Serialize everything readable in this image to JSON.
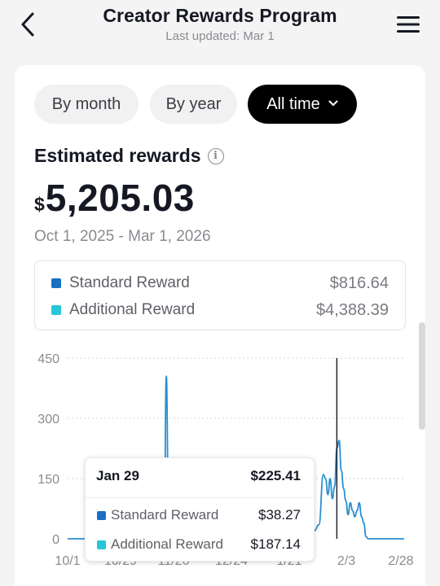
{
  "header": {
    "title": "Creator Rewards Program",
    "subtitle": "Last updated: Mar 1"
  },
  "filters": {
    "by_month": "By month",
    "by_year": "By year",
    "all_time": "All time",
    "selected": "All time"
  },
  "summary": {
    "label": "Estimated rewards",
    "currency": "$",
    "amount": "5,205.03",
    "date_range": "Oct 1, 2025 - Mar 1, 2026"
  },
  "legend": [
    {
      "label": "Standard Reward",
      "value": "$816.64",
      "color": "#1a6fc4"
    },
    {
      "label": "Additional Reward",
      "value": "$4,388.39",
      "color": "#25c6da"
    }
  ],
  "tooltip": {
    "date": "Jan 29",
    "total": "$225.41",
    "rows": [
      {
        "label": "Standard Reward",
        "value": "$38.27",
        "color": "#1a6fc4"
      },
      {
        "label": "Additional Reward",
        "value": "$187.14",
        "color": "#25c6da"
      }
    ]
  },
  "chart_data": {
    "type": "line",
    "y_ticks": [
      "450",
      "300",
      "150",
      "0"
    ],
    "ylim": [
      0,
      450
    ],
    "x_ticks": [
      "10/1",
      "10/29",
      "11/26",
      "12/24",
      "1/21",
      "2/3",
      "2/28"
    ],
    "line_color": "#2a8fd0",
    "cursor_date": "Jan 29",
    "grid": "dashed horizontal",
    "points": [
      {
        "x": "10/1",
        "y": 0
      },
      {
        "x": "10/14",
        "y": 0
      },
      {
        "x": "10/15",
        "y": 2
      },
      {
        "x": "11/12",
        "y": 2
      },
      {
        "x": "11/13",
        "y": 8
      },
      {
        "x": "11/14",
        "y": 405
      },
      {
        "x": "11/15",
        "y": 70
      },
      {
        "x": "11/16",
        "y": 8
      },
      {
        "x": "11/17",
        "y": 2
      },
      {
        "x": "1/14",
        "y": 2
      },
      {
        "x": "1/17",
        "y": 55
      },
      {
        "x": "1/19",
        "y": 20
      },
      {
        "x": "1/21",
        "y": 35
      },
      {
        "x": "1/23",
        "y": 160
      },
      {
        "x": "1/24",
        "y": 150
      },
      {
        "x": "1/25",
        "y": 110
      },
      {
        "x": "1/26",
        "y": 150
      },
      {
        "x": "1/27",
        "y": 100
      },
      {
        "x": "1/28",
        "y": 130
      },
      {
        "x": "1/29",
        "y": 225
      },
      {
        "x": "1/30",
        "y": 245
      },
      {
        "x": "1/31",
        "y": 170
      },
      {
        "x": "2/1",
        "y": 125
      },
      {
        "x": "2/2",
        "y": 95
      },
      {
        "x": "2/3",
        "y": 60
      },
      {
        "x": "2/4",
        "y": 90
      },
      {
        "x": "2/5",
        "y": 70
      },
      {
        "x": "2/6",
        "y": 55
      },
      {
        "x": "2/7",
        "y": 70
      },
      {
        "x": "2/8",
        "y": 90
      },
      {
        "x": "2/9",
        "y": 55
      },
      {
        "x": "2/10",
        "y": 40
      },
      {
        "x": "2/11",
        "y": 5
      },
      {
        "x": "2/12",
        "y": 0
      },
      {
        "x": "2/28",
        "y": 0
      }
    ]
  }
}
